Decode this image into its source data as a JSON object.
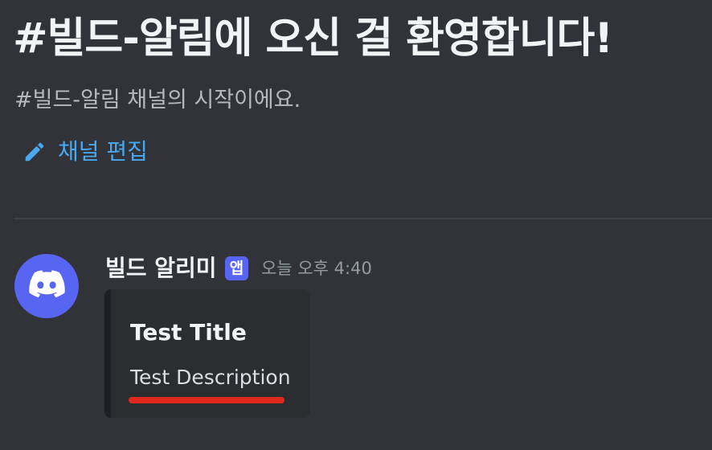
{
  "channel_header": {
    "welcome_title": "#빌드-알림에 오신 걸 환영합니다!",
    "welcome_subtitle": "#빌드-알림 채널의 시작이에요.",
    "edit_channel_label": "채널 편집",
    "edit_icon": "pencil-icon"
  },
  "message": {
    "avatar_icon": "discord-logo-icon",
    "author": "빌드 알리미",
    "app_tag": "앱",
    "timestamp": "오늘 오후 4:40",
    "embed": {
      "title": "Test Title",
      "description": "Test Description"
    }
  },
  "colors": {
    "background": "#313338",
    "accent": "#5865f2",
    "link": "#00a8fc",
    "annotation": "#e0281c"
  }
}
